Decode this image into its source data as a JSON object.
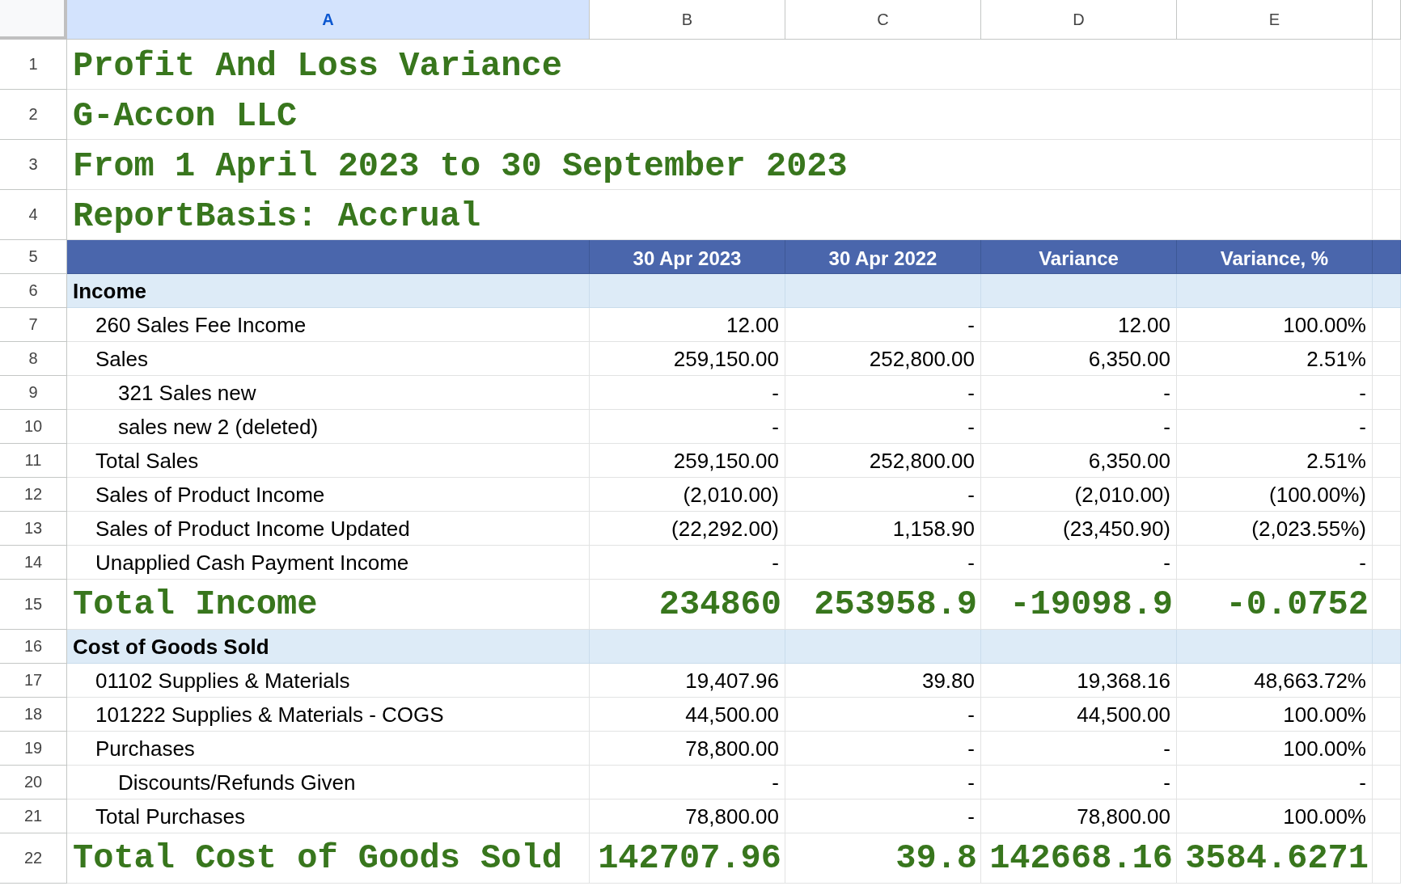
{
  "columns": [
    {
      "label": "A",
      "selected": true
    },
    {
      "label": "B",
      "selected": false
    },
    {
      "label": "C",
      "selected": false
    },
    {
      "label": "D",
      "selected": false
    },
    {
      "label": "E",
      "selected": false
    }
  ],
  "rows": [
    {
      "number": "1",
      "kind": "title",
      "cells": [
        "Profit And Loss Variance"
      ]
    },
    {
      "number": "2",
      "kind": "title",
      "cells": [
        "G-Accon LLC"
      ]
    },
    {
      "number": "3",
      "kind": "title",
      "cells": [
        "From 1 April 2023 to 30 September 2023"
      ]
    },
    {
      "number": "4",
      "kind": "title",
      "cells": [
        "ReportBasis: Accrual"
      ]
    },
    {
      "number": "5",
      "kind": "header",
      "cells": [
        "",
        "30 Apr 2023",
        "30 Apr 2022",
        "Variance",
        "Variance, %"
      ]
    },
    {
      "number": "6",
      "kind": "section",
      "cells": [
        "Income"
      ],
      "children": [
        {
          "number": "7",
          "kind": "line",
          "cells": [
            "260 Sales Fee Income",
            "12.00",
            "-",
            "12.00",
            "100.00%"
          ]
        },
        {
          "number": "8",
          "kind": "line",
          "cells": [
            "Sales",
            "259,150.00",
            "252,800.00",
            "6,350.00",
            "2.51%"
          ],
          "children": [
            {
              "number": "9",
              "kind": "line",
              "cells": [
                "321 Sales new",
                "-",
                "-",
                "-",
                "-"
              ]
            },
            {
              "number": "10",
              "kind": "line",
              "cells": [
                "sales new 2 (deleted)",
                "-",
                "-",
                "-",
                "-"
              ]
            }
          ]
        },
        {
          "number": "11",
          "kind": "line",
          "cells": [
            "Total Sales",
            "259,150.00",
            "252,800.00",
            "6,350.00",
            "2.51%"
          ]
        },
        {
          "number": "12",
          "kind": "line",
          "cells": [
            "Sales of Product Income",
            "(2,010.00)",
            "-",
            "(2,010.00)",
            "(100.00%)"
          ]
        },
        {
          "number": "13",
          "kind": "line",
          "cells": [
            "Sales of Product Income Updated",
            "(22,292.00)",
            "1,158.90",
            "(23,450.90)",
            "(2,023.55%)"
          ]
        },
        {
          "number": "14",
          "kind": "line",
          "cells": [
            "Unapplied Cash Payment Income",
            "-",
            "-",
            "-",
            "-"
          ]
        }
      ]
    },
    {
      "number": "15",
      "kind": "total",
      "cells": [
        "Total Income",
        "234860",
        "253958.9",
        "-19098.9",
        "-0.0752"
      ]
    },
    {
      "number": "16",
      "kind": "section",
      "cells": [
        "Cost of Goods Sold"
      ],
      "children": [
        {
          "number": "17",
          "kind": "line",
          "cells": [
            "01102 Supplies & Materials",
            "19,407.96",
            "39.80",
            "19,368.16",
            "48,663.72%"
          ]
        },
        {
          "number": "18",
          "kind": "line",
          "cells": [
            "101222 Supplies & Materials - COGS",
            "44,500.00",
            "-",
            "44,500.00",
            "100.00%"
          ]
        },
        {
          "number": "19",
          "kind": "line",
          "cells": [
            "Purchases",
            "78,800.00",
            "-",
            "-",
            "100.00%"
          ],
          "children": [
            {
              "number": "20",
              "kind": "line",
              "cells": [
                "Discounts/Refunds Given",
                "-",
                "-",
                "-",
                "-"
              ]
            }
          ]
        },
        {
          "number": "21",
          "kind": "line",
          "cells": [
            "Total Purchases",
            "78,800.00",
            "-",
            "78,800.00",
            "100.00%"
          ]
        }
      ]
    },
    {
      "number": "22",
      "kind": "total",
      "cells": [
        "Total Cost of Goods Sold",
        "142707.96",
        "39.8",
        "142668.16",
        "3584.6271"
      ]
    }
  ]
}
